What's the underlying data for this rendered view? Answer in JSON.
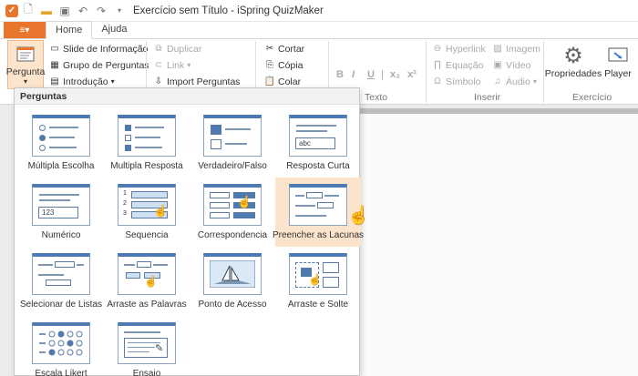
{
  "titlebar": {
    "title": "Exercício sem Título - iSpring QuizMaker",
    "icons": [
      "app-logo",
      "new-icon",
      "open-icon",
      "save-icon",
      "undo-icon",
      "redo-icon",
      "customize-icon"
    ]
  },
  "tabs": {
    "file_icon": "≡▾",
    "items": [
      "Home",
      "Ajuda"
    ],
    "active": "Home"
  },
  "ribbon": {
    "pergunta": "Pergunta",
    "slide_info": "Slide de Informação",
    "grupo": "Grupo de Perguntas",
    "introducao": "Introdução",
    "duplicar": "Duplicar",
    "link": "Link",
    "import": "Import Perguntas",
    "cortar": "Cortar",
    "copia": "Cópia",
    "colar": "Colar",
    "texto_label": "Texto",
    "hyperlink": "Hyperlink",
    "equacao": "Equação",
    "simbolo": "Símbolo",
    "imagem": "Imagem",
    "video": "Vídeo",
    "audio": "Áudio",
    "inserir_label": "Inserir",
    "propriedades": "Propriedades",
    "player": "Player",
    "exercicio_label": "Exercício",
    "format_buttons": [
      "B",
      "I",
      "U",
      "|",
      "x₂",
      "x²"
    ]
  },
  "dropdown": {
    "header": "Perguntas",
    "items": [
      {
        "label": "Múltipla Escolha",
        "icon": "multiple-choice-icon"
      },
      {
        "label": "Multipla Resposta",
        "icon": "multiple-response-icon"
      },
      {
        "label": "Verdadeiro/Falso",
        "icon": "true-false-icon"
      },
      {
        "label": "Resposta Curta",
        "icon": "short-answer-icon"
      },
      {
        "label": "Numérico",
        "icon": "numeric-icon"
      },
      {
        "label": "Sequencia",
        "icon": "sequence-icon"
      },
      {
        "label": "Correspondencia",
        "icon": "matching-icon"
      },
      {
        "label": "Preencher as Lacunas",
        "icon": "fill-in-blanks-icon"
      },
      {
        "label": "Selecionar de Listas",
        "icon": "select-from-lists-icon"
      },
      {
        "label": "Arraste as Palavras",
        "icon": "drag-words-icon"
      },
      {
        "label": "Ponto de Acesso",
        "icon": "hotspot-icon"
      },
      {
        "label": "Arraste e Solte",
        "icon": "drag-drop-icon"
      },
      {
        "label": "Escala Likert",
        "icon": "likert-scale-icon"
      },
      {
        "label": "Ensaio",
        "icon": "essay-icon"
      }
    ],
    "hovered": "Preencher as Lacunas",
    "short_answer_sample": "abc",
    "numeric_sample": "123",
    "sequence_numbers": [
      "1",
      "2",
      "3"
    ]
  },
  "colors": {
    "accent": "#e8762c",
    "hover": "#fce3cc",
    "thumb_header": "#4d7ab0"
  }
}
